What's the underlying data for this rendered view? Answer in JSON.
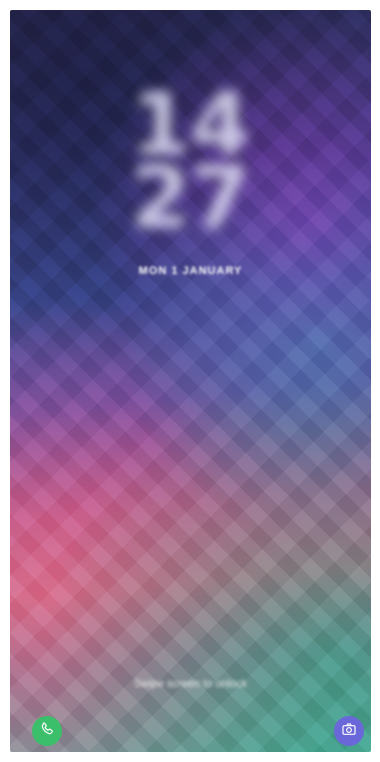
{
  "lockscreen": {
    "clock_hour": "14",
    "clock_minute": "27",
    "date": "MON 1 JANUARY",
    "unlock_hint": "Swipe screen to unlock"
  },
  "shortcuts": {
    "left_icon": "phone-icon",
    "right_icon": "camera-icon"
  },
  "colors": {
    "phone_button": "#3bbf6a",
    "camera_button": "#6a68d8"
  }
}
